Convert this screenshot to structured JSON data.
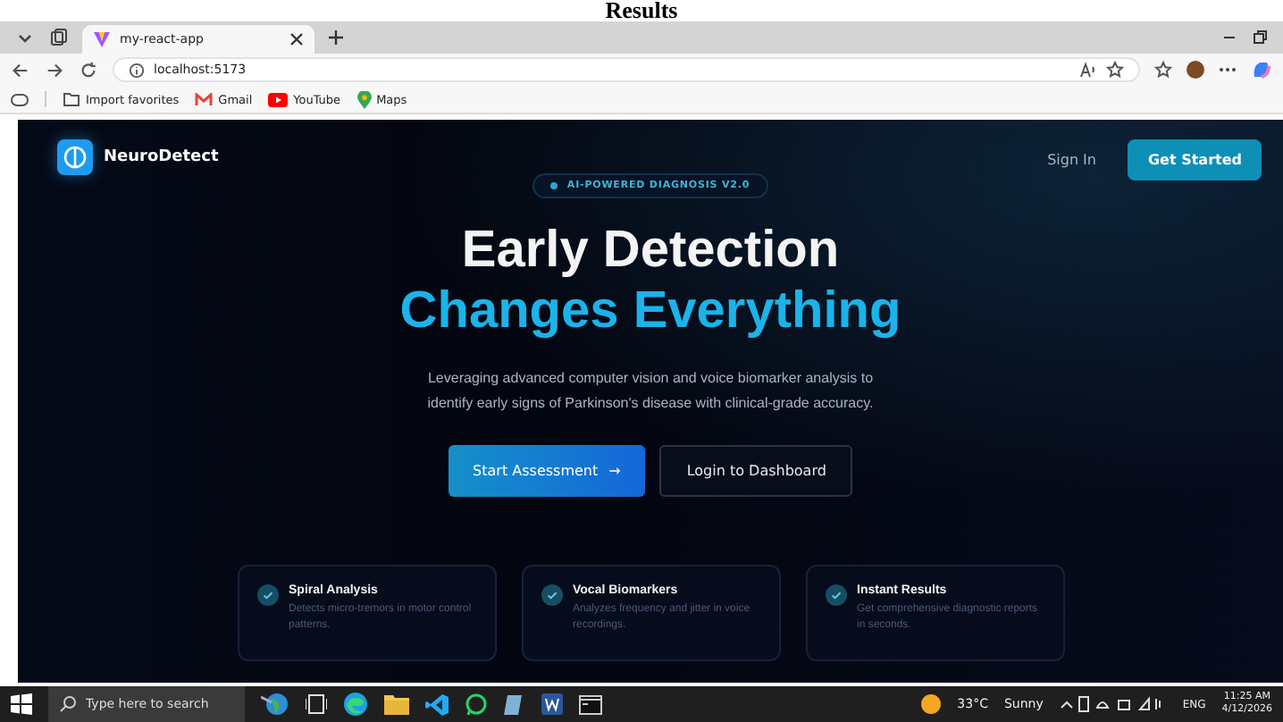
{
  "document_heading": "Results",
  "browser": {
    "tab_title": "my-react-app",
    "address": "localhost:5173",
    "bookmarks": [
      {
        "label": "Import favorites",
        "kind": "folder"
      },
      {
        "label": "Gmail",
        "kind": "gmail"
      },
      {
        "label": "YouTube",
        "kind": "youtube"
      },
      {
        "label": "Maps",
        "kind": "maps"
      }
    ]
  },
  "nav": {
    "brand": "NeuroDetect",
    "links": [
      "Sign In"
    ],
    "cta": "Get Started"
  },
  "hero": {
    "badge": "AI-POWERED DIAGNOSIS V2.0",
    "title_line_1": "Early Detection",
    "title_line_2": "Changes Everything",
    "subtitle": "Leveraging advanced computer vision and voice biomarker analysis to identify early signs of Parkinson's disease with clinical-grade accuracy.",
    "primary_button": "Start Assessment",
    "arrow": "→",
    "secondary_button": "Login to Dashboard"
  },
  "features": [
    {
      "title": "Spiral Analysis",
      "description": "Detects micro-tremors in motor control patterns."
    },
    {
      "title": "Vocal Biomarkers",
      "description": "Analyzes frequency and jitter in voice recordings."
    },
    {
      "title": "Instant Results",
      "description": "Get comprehensive diagnostic reports in seconds."
    }
  ],
  "taskbar": {
    "search_placeholder": "Type here to search",
    "temperature": "33°C",
    "weather": "Sunny",
    "language": "ENG",
    "time": "11:25 AM",
    "date": "4/12/2026"
  }
}
